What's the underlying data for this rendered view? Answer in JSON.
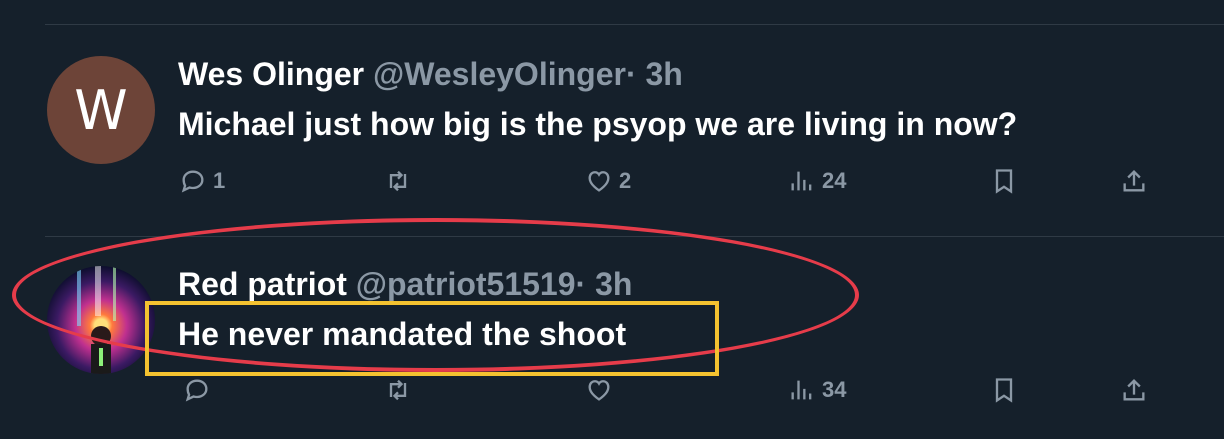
{
  "tweets": [
    {
      "avatar_letter": "W",
      "name": "Wes Olinger",
      "handle": "@WesleyOlinger",
      "time": "· 3h",
      "text": "Michael just how big is the psyop we are living in now?",
      "replies": "1",
      "retweets": "",
      "likes": "2",
      "views": "24"
    },
    {
      "avatar_letter": "",
      "name": "Red patriot",
      "handle": "@patriot51519",
      "time": "· 3h",
      "text": "He never mandated the shoot",
      "replies": "",
      "retweets": "",
      "likes": "",
      "views": "34"
    }
  ],
  "colors": {
    "background": "#15202b",
    "muted_text": "#8b98a5",
    "annotation_red": "#e63c4a",
    "annotation_yellow": "#f4c230",
    "avatar_w": "#6d4438"
  },
  "icons": [
    "reply-icon",
    "retweet-icon",
    "like-icon",
    "views-icon",
    "bookmark-icon",
    "share-icon"
  ]
}
